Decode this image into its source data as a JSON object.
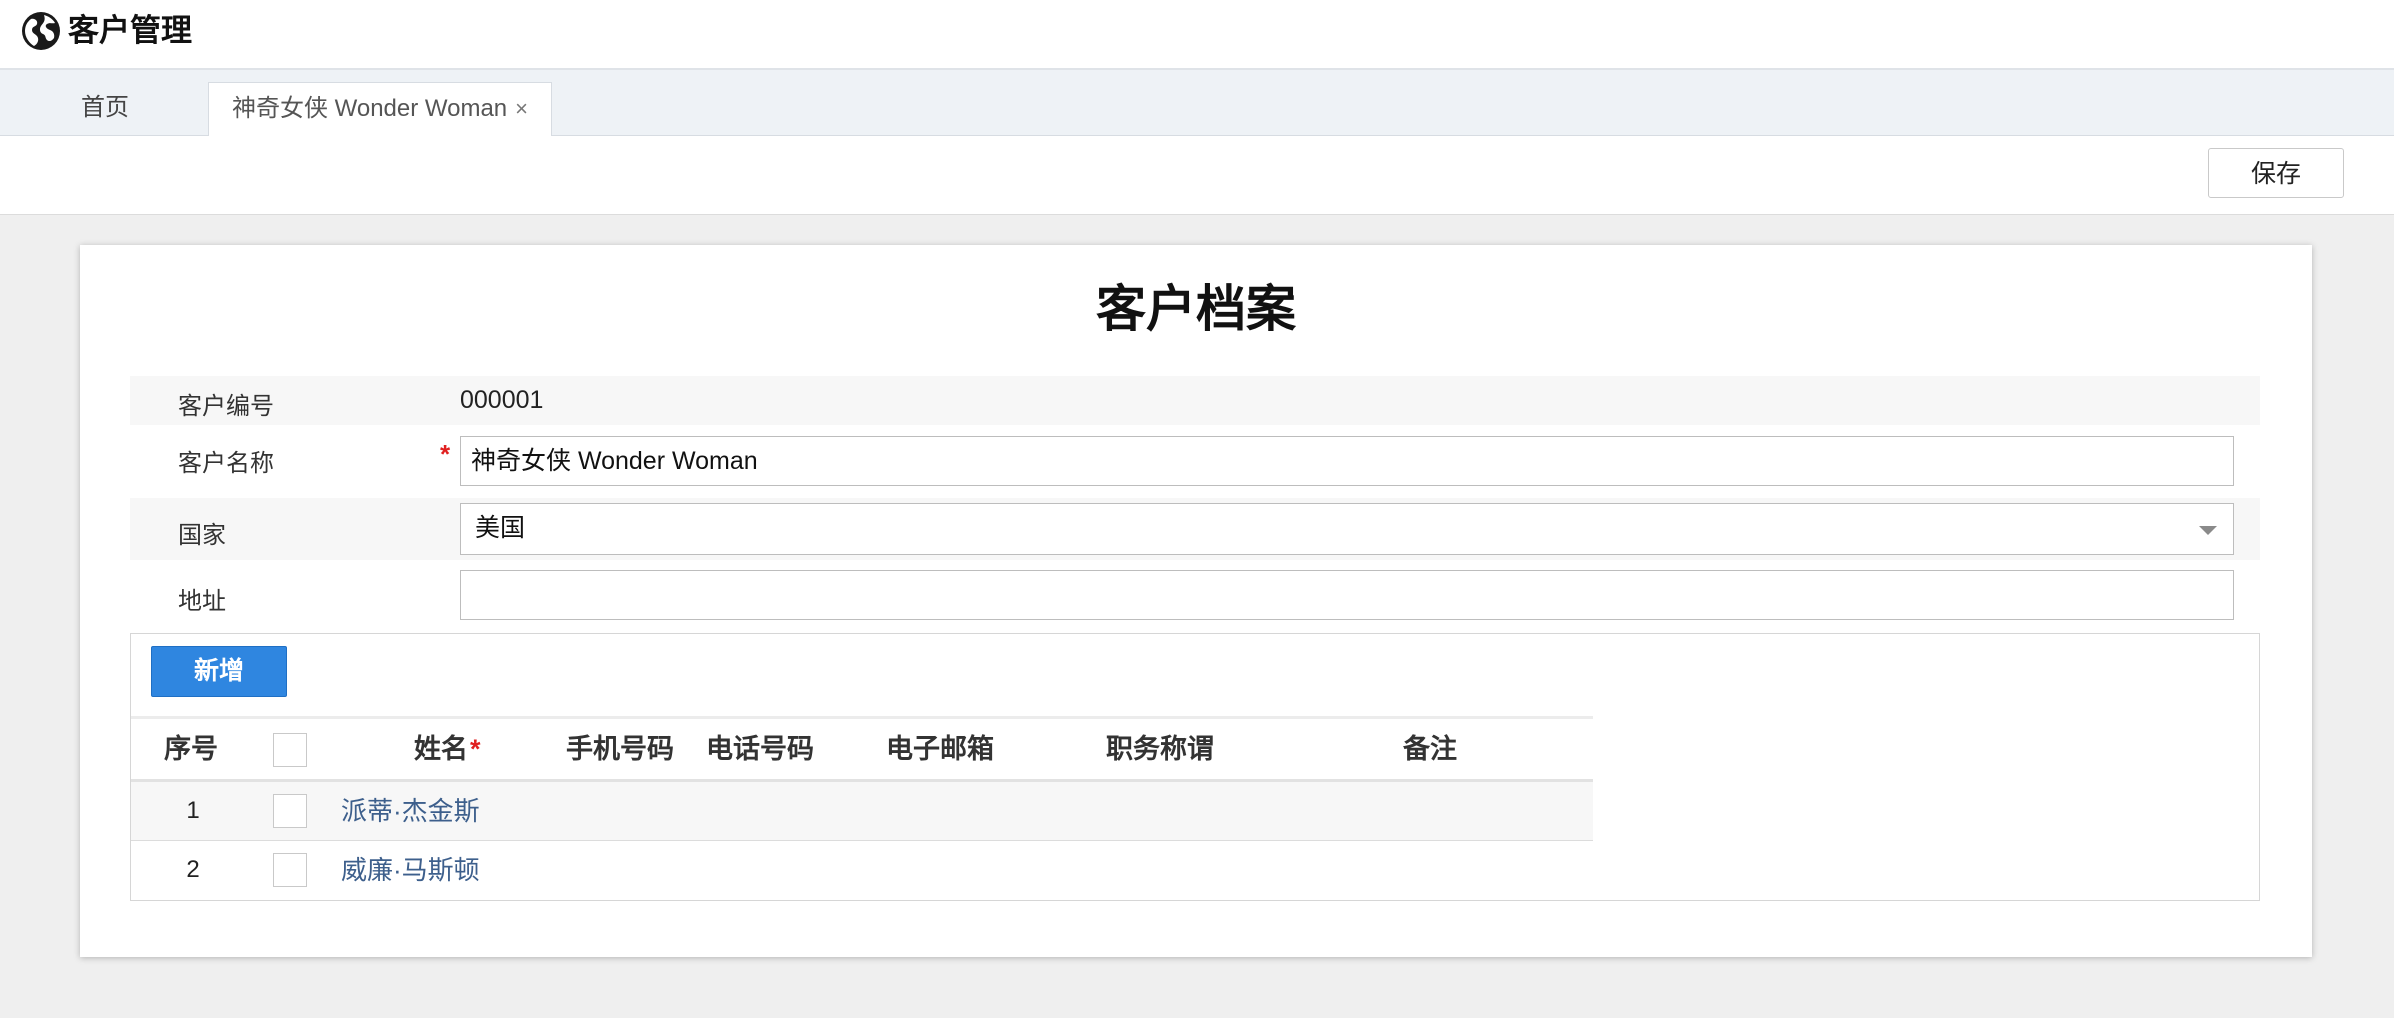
{
  "header": {
    "title": "客户管理",
    "logo_icon": "globe-icon"
  },
  "tabs": [
    {
      "label": "首页",
      "active": false
    },
    {
      "label": "神奇女侠 Wonder Woman",
      "active": true,
      "close_glyph": "×"
    }
  ],
  "toolbar": {
    "save_label": "保存"
  },
  "form": {
    "title": "客户档案",
    "fields": {
      "code": {
        "label": "客户编号",
        "value": "000001"
      },
      "name": {
        "label": "客户名称",
        "required_mark": "*",
        "value": "神奇女侠 Wonder Woman"
      },
      "country": {
        "label": "国家",
        "value": "美国"
      },
      "address": {
        "label": "地址",
        "value": ""
      }
    }
  },
  "contacts": {
    "add_label": "新增",
    "columns": {
      "seq": "序号",
      "name": "姓名",
      "name_required": "*",
      "mobile": "手机号码",
      "phone": "电话号码",
      "email": "电子邮箱",
      "position": "职务称谓",
      "remark": "备注"
    },
    "rows": [
      {
        "seq": "1",
        "name": "派蒂·杰金斯"
      },
      {
        "seq": "2",
        "name": "威廉·马斯顿"
      }
    ]
  },
  "colors": {
    "accent": "#2f86e0",
    "link": "#3d5f8c",
    "required": "#e02020"
  }
}
